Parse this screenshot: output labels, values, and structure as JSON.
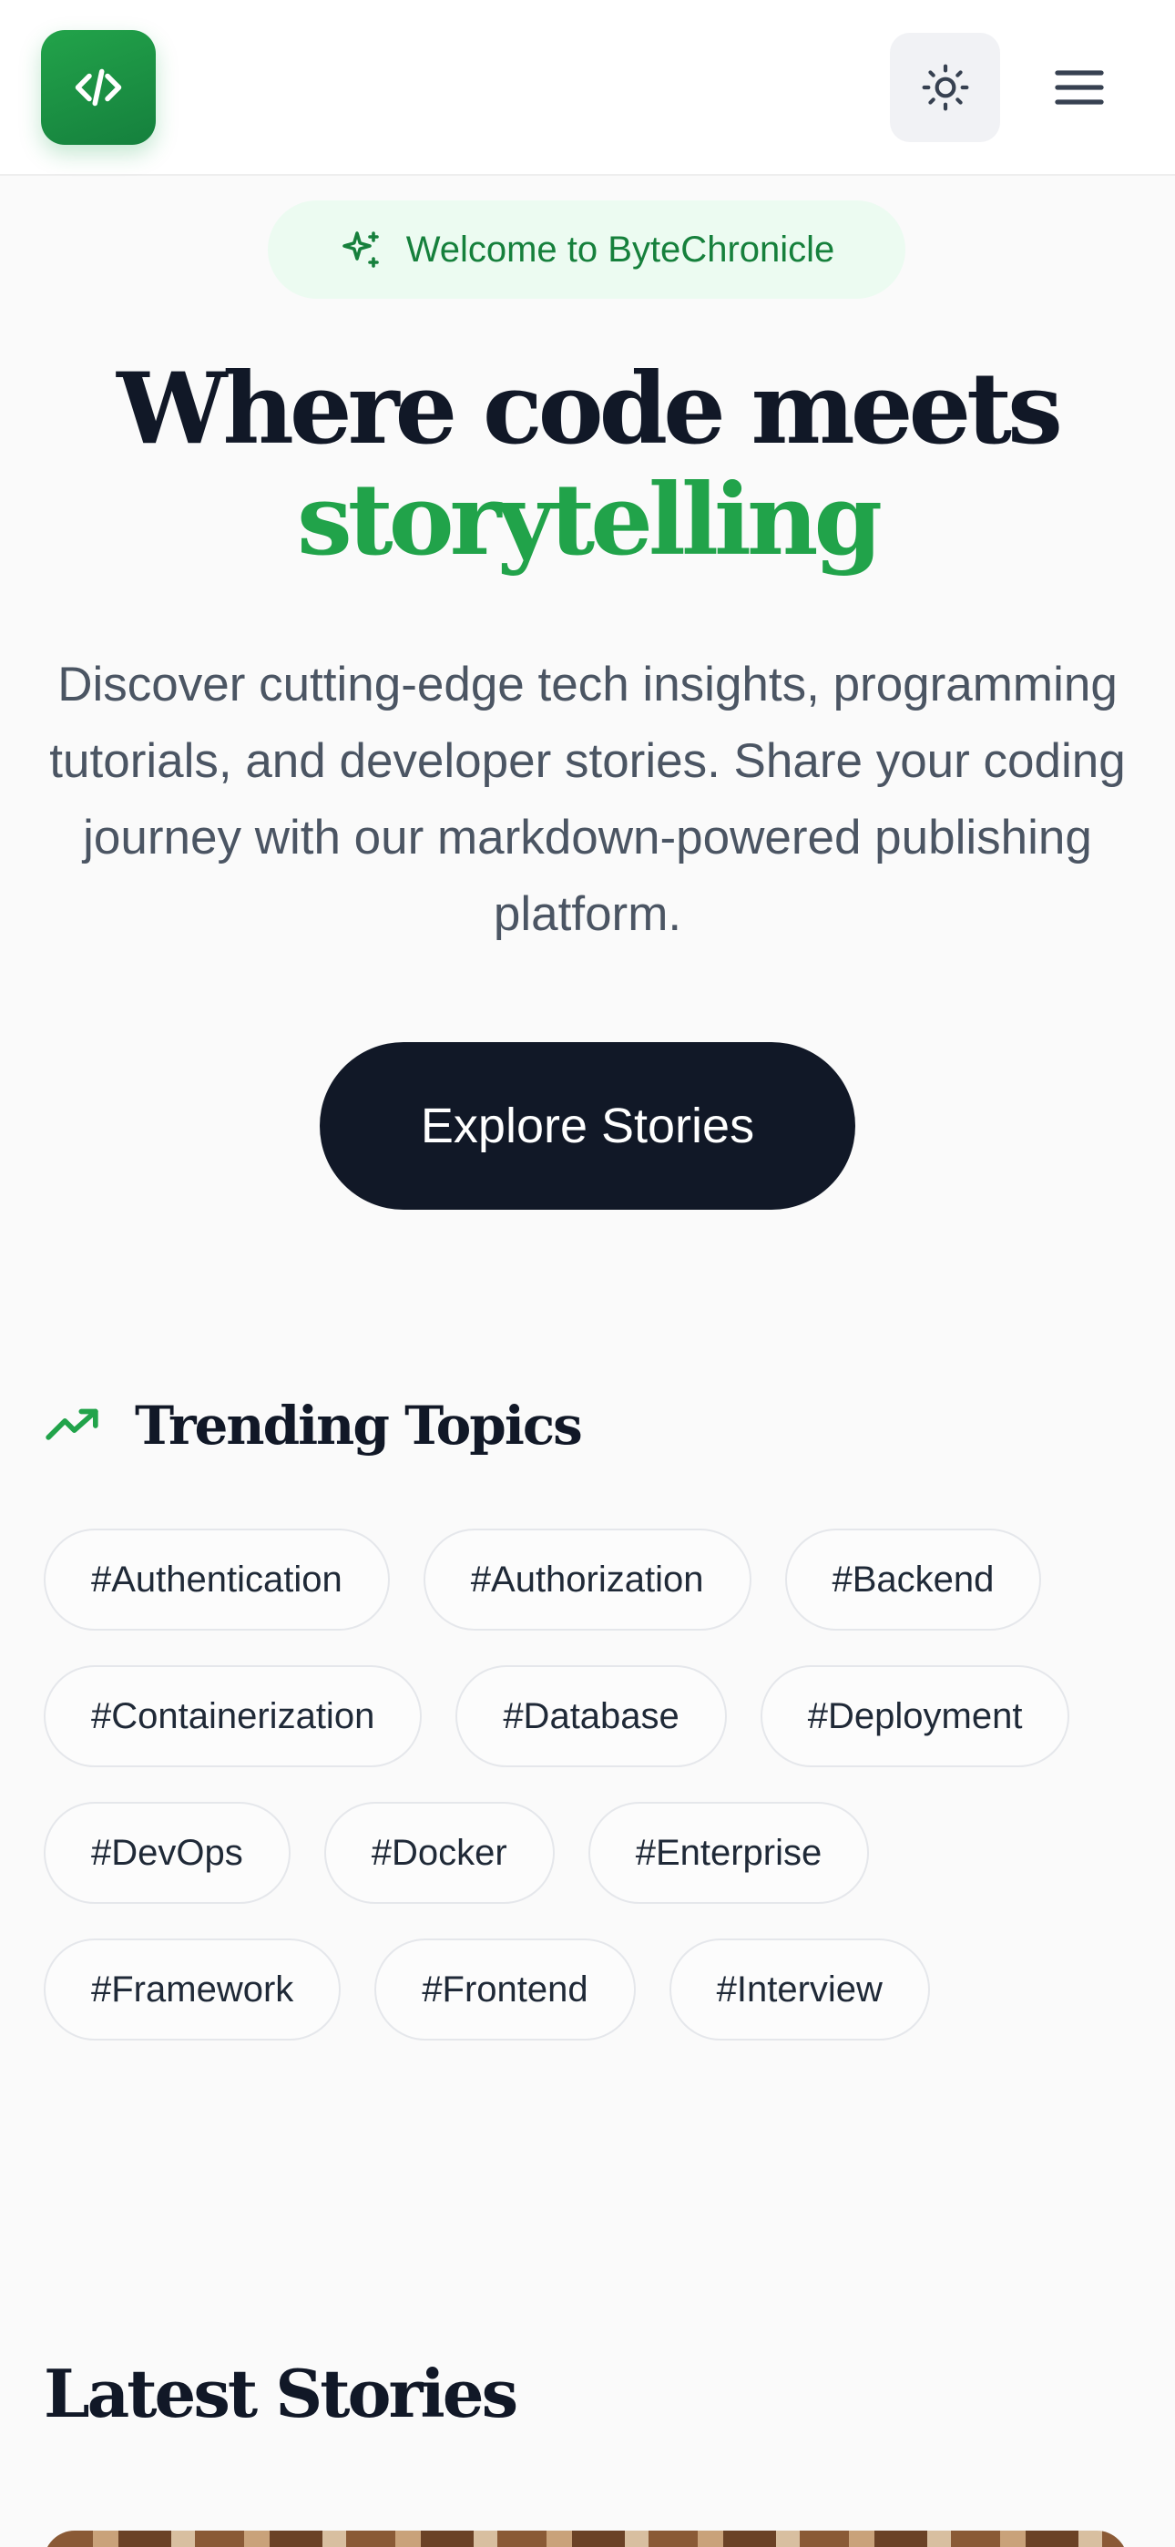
{
  "header": {
    "logo_icon": "code-brackets-icon",
    "theme_toggle_icon": "sun-icon",
    "menu_icon": "hamburger-menu-icon"
  },
  "hero": {
    "badge_icon": "sparkles-icon",
    "badge_text": "Welcome to ByteChronicle",
    "title_line1": "Where code meets",
    "title_accent": "storytelling",
    "description": "Discover cutting-edge tech insights, programming tutorials, and developer stories. Share your coding journey with our markdown-powered publishing platform.",
    "cta_label": "Explore Stories"
  },
  "trending": {
    "icon": "trending-up-icon",
    "title": "Trending Topics",
    "tags": [
      "#Authentication",
      "#Authorization",
      "#Backend",
      "#Containerization",
      "#Database",
      "#Deployment",
      "#DevOps",
      "#Docker",
      "#Enterprise",
      "#Framework",
      "#Frontend",
      "#Interview"
    ]
  },
  "latest": {
    "title": "Latest Stories"
  },
  "colors": {
    "brand_green": "#21a34a",
    "dark": "#111827",
    "badge_bg": "#ecfbf1"
  }
}
